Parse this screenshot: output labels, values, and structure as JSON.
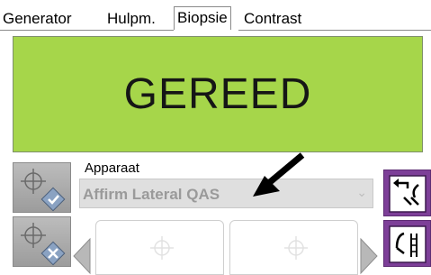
{
  "tabs": [
    {
      "label": "Generator"
    },
    {
      "label": "Hulpm."
    },
    {
      "label": "Biopsie",
      "active": true
    },
    {
      "label": "Contrast"
    }
  ],
  "status": {
    "text": "GEREED",
    "color": "#a6d64a"
  },
  "device": {
    "label": "Apparaat",
    "value": "Affirm Lateral QAS"
  },
  "left_buttons": [
    {
      "icon": "crosshair-check-icon"
    },
    {
      "icon": "crosshair-delete-icon"
    }
  ],
  "right_buttons": [
    {
      "icon": "switch-arrows-icon"
    },
    {
      "icon": "needle-gauge-icon"
    }
  ],
  "colors": {
    "accent_purple": "#7d3f98",
    "status_green": "#a6d64a"
  }
}
